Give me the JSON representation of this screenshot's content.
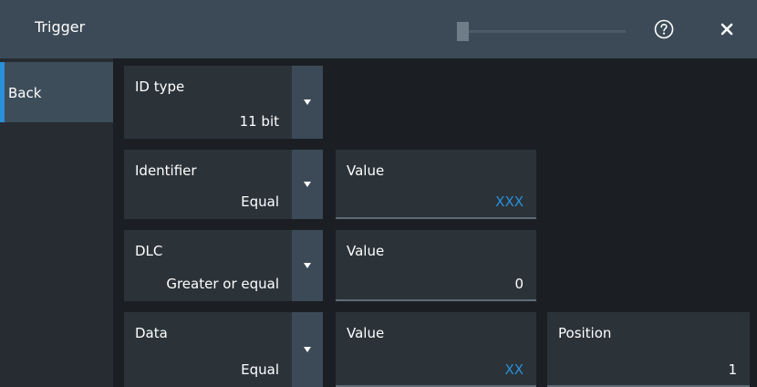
{
  "header": {
    "title": "Trigger",
    "help_icon": "help-circle-icon",
    "close_icon": "close-icon"
  },
  "sidebar": {
    "back_label": "Back"
  },
  "rows": [
    {
      "label": "ID type",
      "value": "11 bit"
    },
    {
      "label": "Identifier",
      "value": "Equal",
      "value_field": {
        "label": "Value",
        "value": "XXX"
      }
    },
    {
      "label": "DLC",
      "value": "Greater or equal",
      "value_field": {
        "label": "Value",
        "value": "0"
      }
    },
    {
      "label": "Data",
      "value": "Equal",
      "value_field": {
        "label": "Value",
        "value": "XX"
      },
      "position_field": {
        "label": "Position",
        "value": "1"
      }
    }
  ],
  "colors": {
    "accent": "#2a8fd8",
    "titlebar": "#3b4a56",
    "background": "#1b1f23"
  }
}
